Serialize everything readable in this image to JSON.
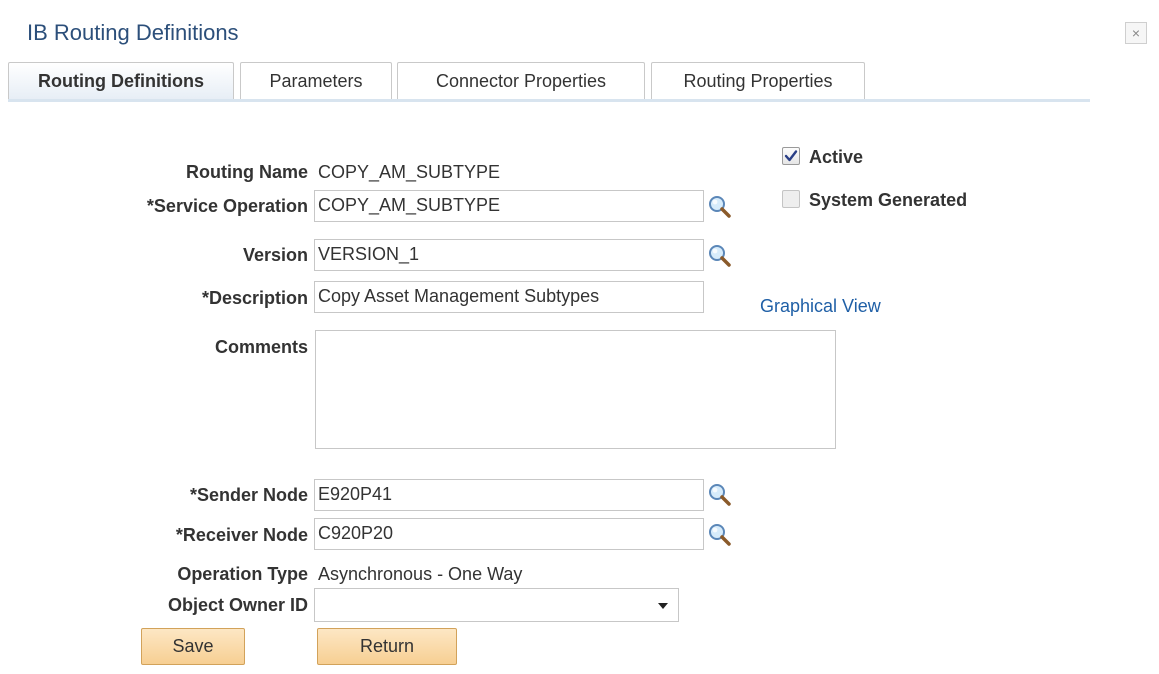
{
  "window": {
    "title": "IB Routing Definitions",
    "close_glyph": "×"
  },
  "tabs": [
    {
      "label": "Routing Definitions",
      "active": true
    },
    {
      "label": "Parameters",
      "active": false
    },
    {
      "label": "Connector Properties",
      "active": false
    },
    {
      "label": "Routing Properties",
      "active": false
    }
  ],
  "form": {
    "routing_name_label": "Routing Name",
    "routing_name_value": "COPY_AM_SUBTYPE",
    "service_operation_label": "*Service Operation",
    "service_operation_value": "COPY_AM_SUBTYPE",
    "version_label": "Version",
    "version_value": "VERSION_1",
    "description_label": "*Description",
    "description_value": "Copy Asset Management Subtypes",
    "comments_label": "Comments",
    "comments_value": "",
    "sender_node_label": "*Sender Node",
    "sender_node_value": "E920P41",
    "receiver_node_label": "*Receiver Node",
    "receiver_node_value": "C920P20",
    "operation_type_label": "Operation Type",
    "operation_type_value": "Asynchronous - One Way",
    "object_owner_label": "Object Owner ID",
    "object_owner_value": ""
  },
  "options": {
    "active_label": "Active",
    "active_checked": true,
    "system_generated_label": "System Generated",
    "system_generated_checked": false,
    "graphical_view_link": "Graphical View"
  },
  "buttons": {
    "save_label": "Save",
    "return_label": "Return"
  },
  "icons": {
    "lookup": "magnifier-icon",
    "checkbox": "checkmark-icon",
    "dropdown": "chevron-down-icon"
  },
  "colors": {
    "title": "#2c4f7a",
    "link": "#1f5fa6",
    "button_fill": "#f7cf93",
    "tab_underline": "#d8e4ef"
  }
}
